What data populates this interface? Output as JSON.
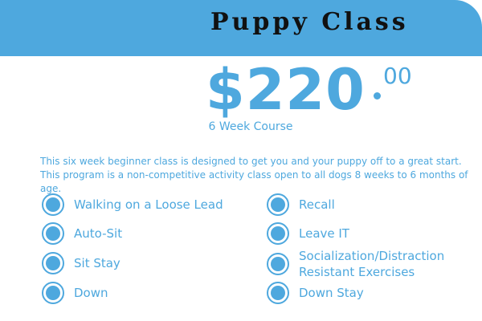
{
  "header": {
    "title": "Puppy Class"
  },
  "pricing": {
    "dollars": "$220",
    "cents": "00",
    "subtitle": "6 Week Course"
  },
  "description": "This six week beginner class is designed to get you and your puppy off to a great start. This program is a non-competitive activity class open to all dogs 8 weeks to 6 months of age.",
  "features_left": [
    {
      "label": "Walking on a Loose Lead"
    },
    {
      "label": "Auto-Sit"
    },
    {
      "label": "Sit Stay"
    },
    {
      "label": "Down"
    }
  ],
  "features_right": [
    {
      "label": "Recall"
    },
    {
      "label": "Leave IT"
    },
    {
      "line1": "Socialization/Distraction",
      "line2": "Resistant Exercises"
    },
    {
      "label": "Down Stay"
    }
  ],
  "colors": {
    "accent": "#4ea8de",
    "title": "#111111",
    "background": "#ffffff"
  }
}
